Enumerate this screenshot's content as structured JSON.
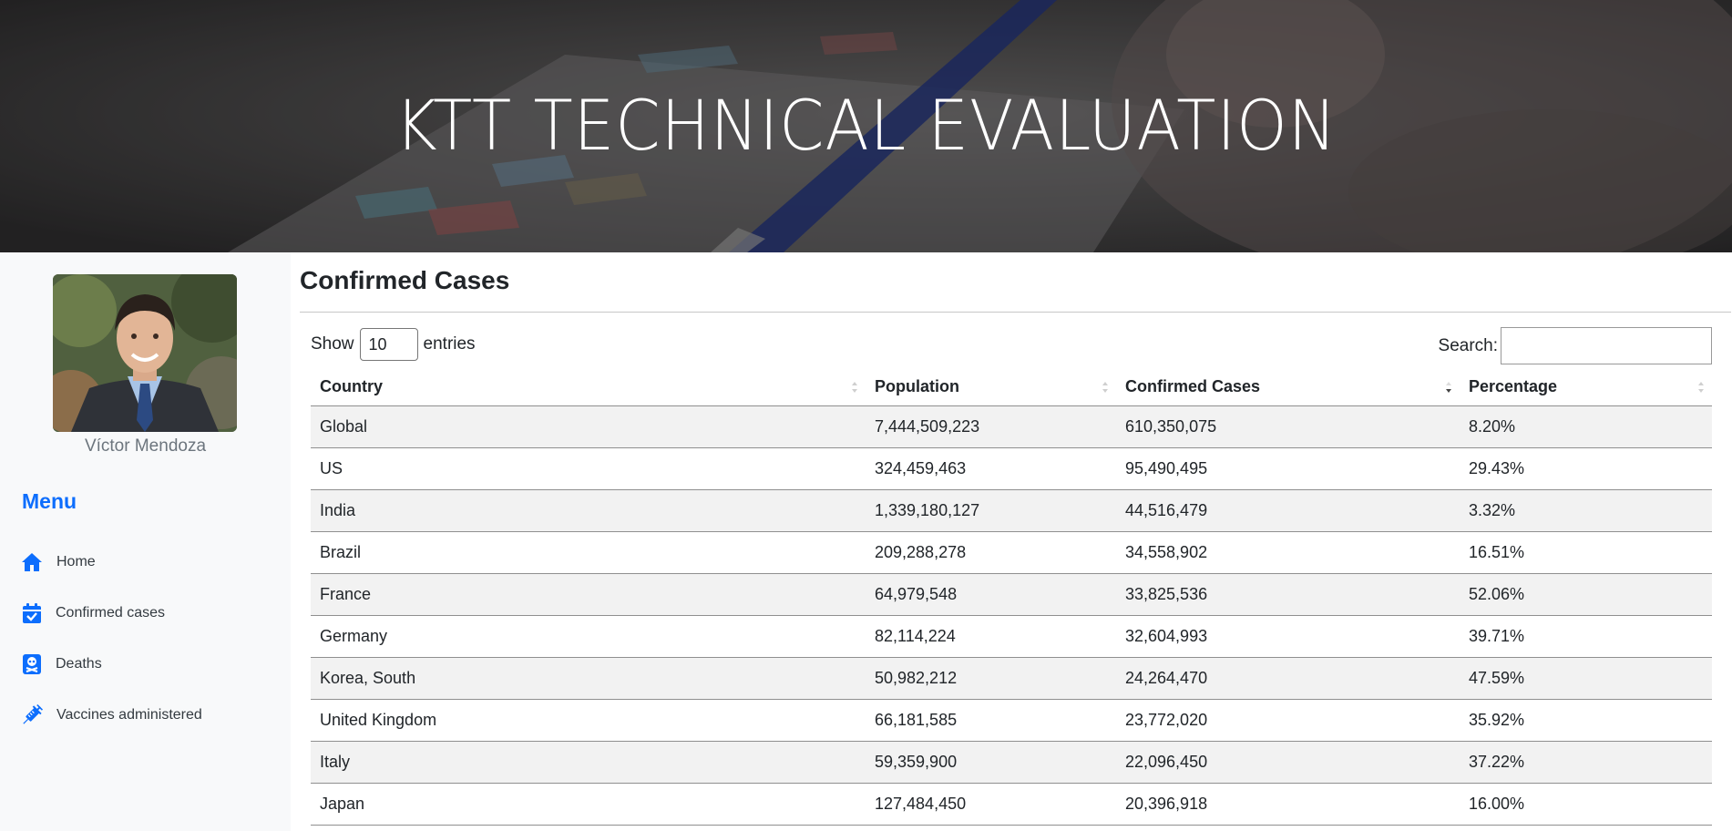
{
  "hero": {
    "title": "KTT TECHNICAL EVALUATION"
  },
  "sidebar": {
    "profile_name": "Víctor Mendoza",
    "menu_title": "Menu",
    "items": [
      {
        "label": "Home",
        "icon": "home-icon"
      },
      {
        "label": "Confirmed cases",
        "icon": "calendar-check-icon"
      },
      {
        "label": "Deaths",
        "icon": "skull-crossbones-icon"
      },
      {
        "label": "Vaccines administered",
        "icon": "syringe-icon"
      }
    ]
  },
  "main": {
    "title": "Confirmed Cases",
    "length": {
      "show_label": "Show",
      "selected": "10",
      "entries_label": "entries"
    },
    "search": {
      "label": "Search:",
      "value": ""
    },
    "table": {
      "columns": [
        "Country",
        "Population",
        "Confirmed Cases",
        "Percentage"
      ],
      "sorted_column": "Confirmed Cases",
      "sort_direction": "descending",
      "rows": [
        [
          "Global",
          "7,444,509,223",
          "610,350,075",
          "8.20%"
        ],
        [
          "US",
          "324,459,463",
          "95,490,495",
          "29.43%"
        ],
        [
          "India",
          "1,339,180,127",
          "44,516,479",
          "3.32%"
        ],
        [
          "Brazil",
          "209,288,278",
          "34,558,902",
          "16.51%"
        ],
        [
          "France",
          "64,979,548",
          "33,825,536",
          "52.06%"
        ],
        [
          "Germany",
          "82,114,224",
          "32,604,993",
          "39.71%"
        ],
        [
          "Korea, South",
          "50,982,212",
          "24,264,470",
          "47.59%"
        ],
        [
          "United Kingdom",
          "66,181,585",
          "23,772,020",
          "35.92%"
        ],
        [
          "Italy",
          "59,359,900",
          "22,096,450",
          "37.22%"
        ],
        [
          "Japan",
          "127,484,450",
          "20,396,918",
          "16.00%"
        ]
      ]
    }
  },
  "colors": {
    "accent": "#0d6efd",
    "sidebar_bg": "#f8f9fa",
    "stripe": "#f2f2f2"
  }
}
